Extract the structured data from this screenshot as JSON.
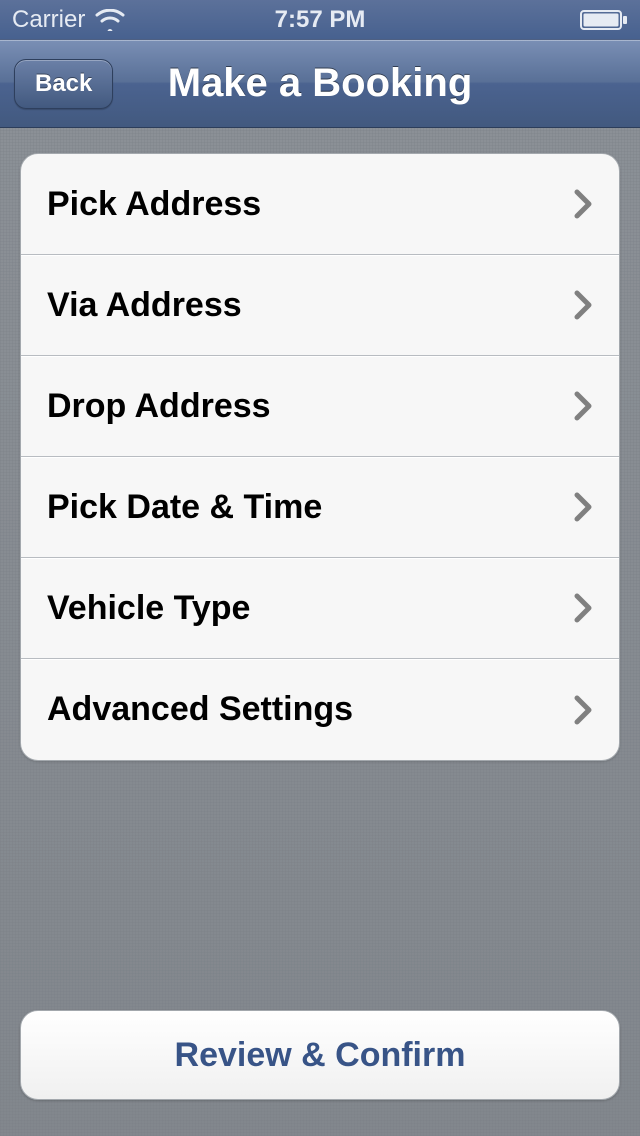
{
  "statusbar": {
    "carrier": "Carrier",
    "time": "7:57 PM"
  },
  "nav": {
    "back_label": "Back",
    "title": "Make a Booking"
  },
  "rows": [
    {
      "label": "Pick Address"
    },
    {
      "label": "Via Address"
    },
    {
      "label": "Drop Address"
    },
    {
      "label": "Pick Date & Time"
    },
    {
      "label": "Vehicle Type"
    },
    {
      "label": "Advanced Settings"
    }
  ],
  "footer": {
    "confirm_label": "Review & Confirm"
  }
}
